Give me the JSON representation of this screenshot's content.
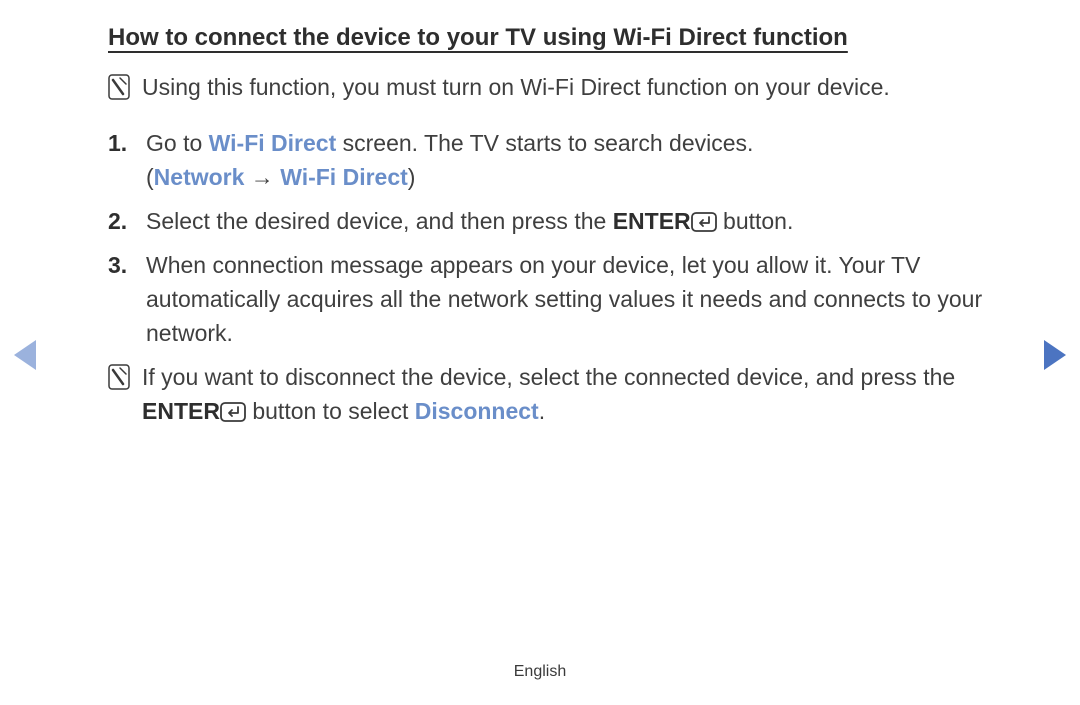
{
  "title": "How to connect the device to your TV using Wi-Fi Direct function",
  "intro_note": "Using this function, you must turn on Wi-Fi Direct function on your device.",
  "steps": [
    {
      "num": "1.",
      "pre": "Go to ",
      "link": "Wi-Fi Direct",
      "post": " screen. The TV starts to search devices.",
      "sub_open": "(",
      "sub_a": "Network",
      "sub_arrow": " → ",
      "sub_b": "Wi-Fi Direct",
      "sub_close": ")"
    },
    {
      "num": "2.",
      "pre": "Select the desired device, and then press the ",
      "enter": "ENTER",
      "post": " button."
    },
    {
      "num": "3.",
      "text": "When connection message appears on your device, let you allow it. Your TV automatically acquires all the network setting values it needs and connects to your network."
    }
  ],
  "disconnect_note": {
    "pre": "If you want to disconnect the device, select the connected device, and press the ",
    "enter": "ENTER",
    "mid": " button to select ",
    "disc": "Disconnect",
    "end": "."
  },
  "footer": "English"
}
